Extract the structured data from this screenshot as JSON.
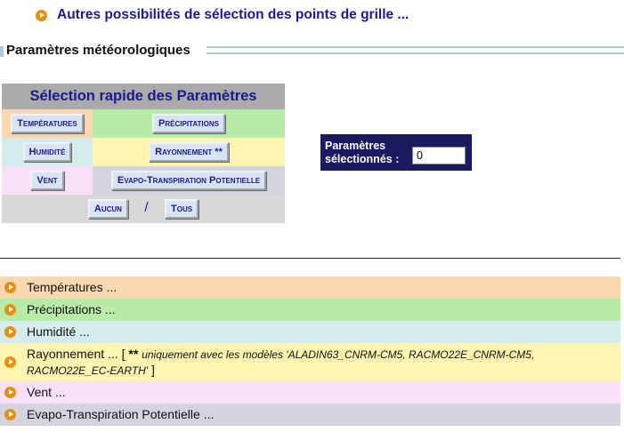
{
  "top_link": {
    "text": "Autres possibilités de sélection des points de grille ...",
    "icon": "orange-play-icon"
  },
  "section": {
    "title": "Paramètres météorologiques"
  },
  "quick_select": {
    "header": "Sélection rapide des Paramètres",
    "buttons": {
      "temperatures": "Températures",
      "precipitations": "Précipitations",
      "humidite": "Humidité",
      "rayonnement": "Rayonnement **",
      "vent": "Vent",
      "etp": "Evapo-Transpiration Potentielle",
      "aucun": "Aucun",
      "tous": "Tous"
    },
    "separator": "/"
  },
  "selected": {
    "label_line1": "Paramètres",
    "label_line2": "sélectionnés :",
    "value": "0"
  },
  "params": [
    {
      "label": "Températures ...",
      "color": "#f8d8b0"
    },
    {
      "label": "Précipitations ...",
      "color": "#b8eaa8"
    },
    {
      "label": "Humidité ...",
      "color": "#d4ecec"
    },
    {
      "label": "Rayonnement ... [",
      "note_stars": "**",
      "note": "uniquement avec les modèles 'ALADIN63_CNRM-CM5, RACMO22E_CNRM-CM5, RACMO22E_EC-EARTH'",
      "note_end": "]",
      "color": "#fcf4b0"
    },
    {
      "label": "Vent ...",
      "color": "#f8e0f8"
    },
    {
      "label": "Evapo-Transpiration Potentielle ...",
      "color": "#d4d4e0"
    }
  ]
}
